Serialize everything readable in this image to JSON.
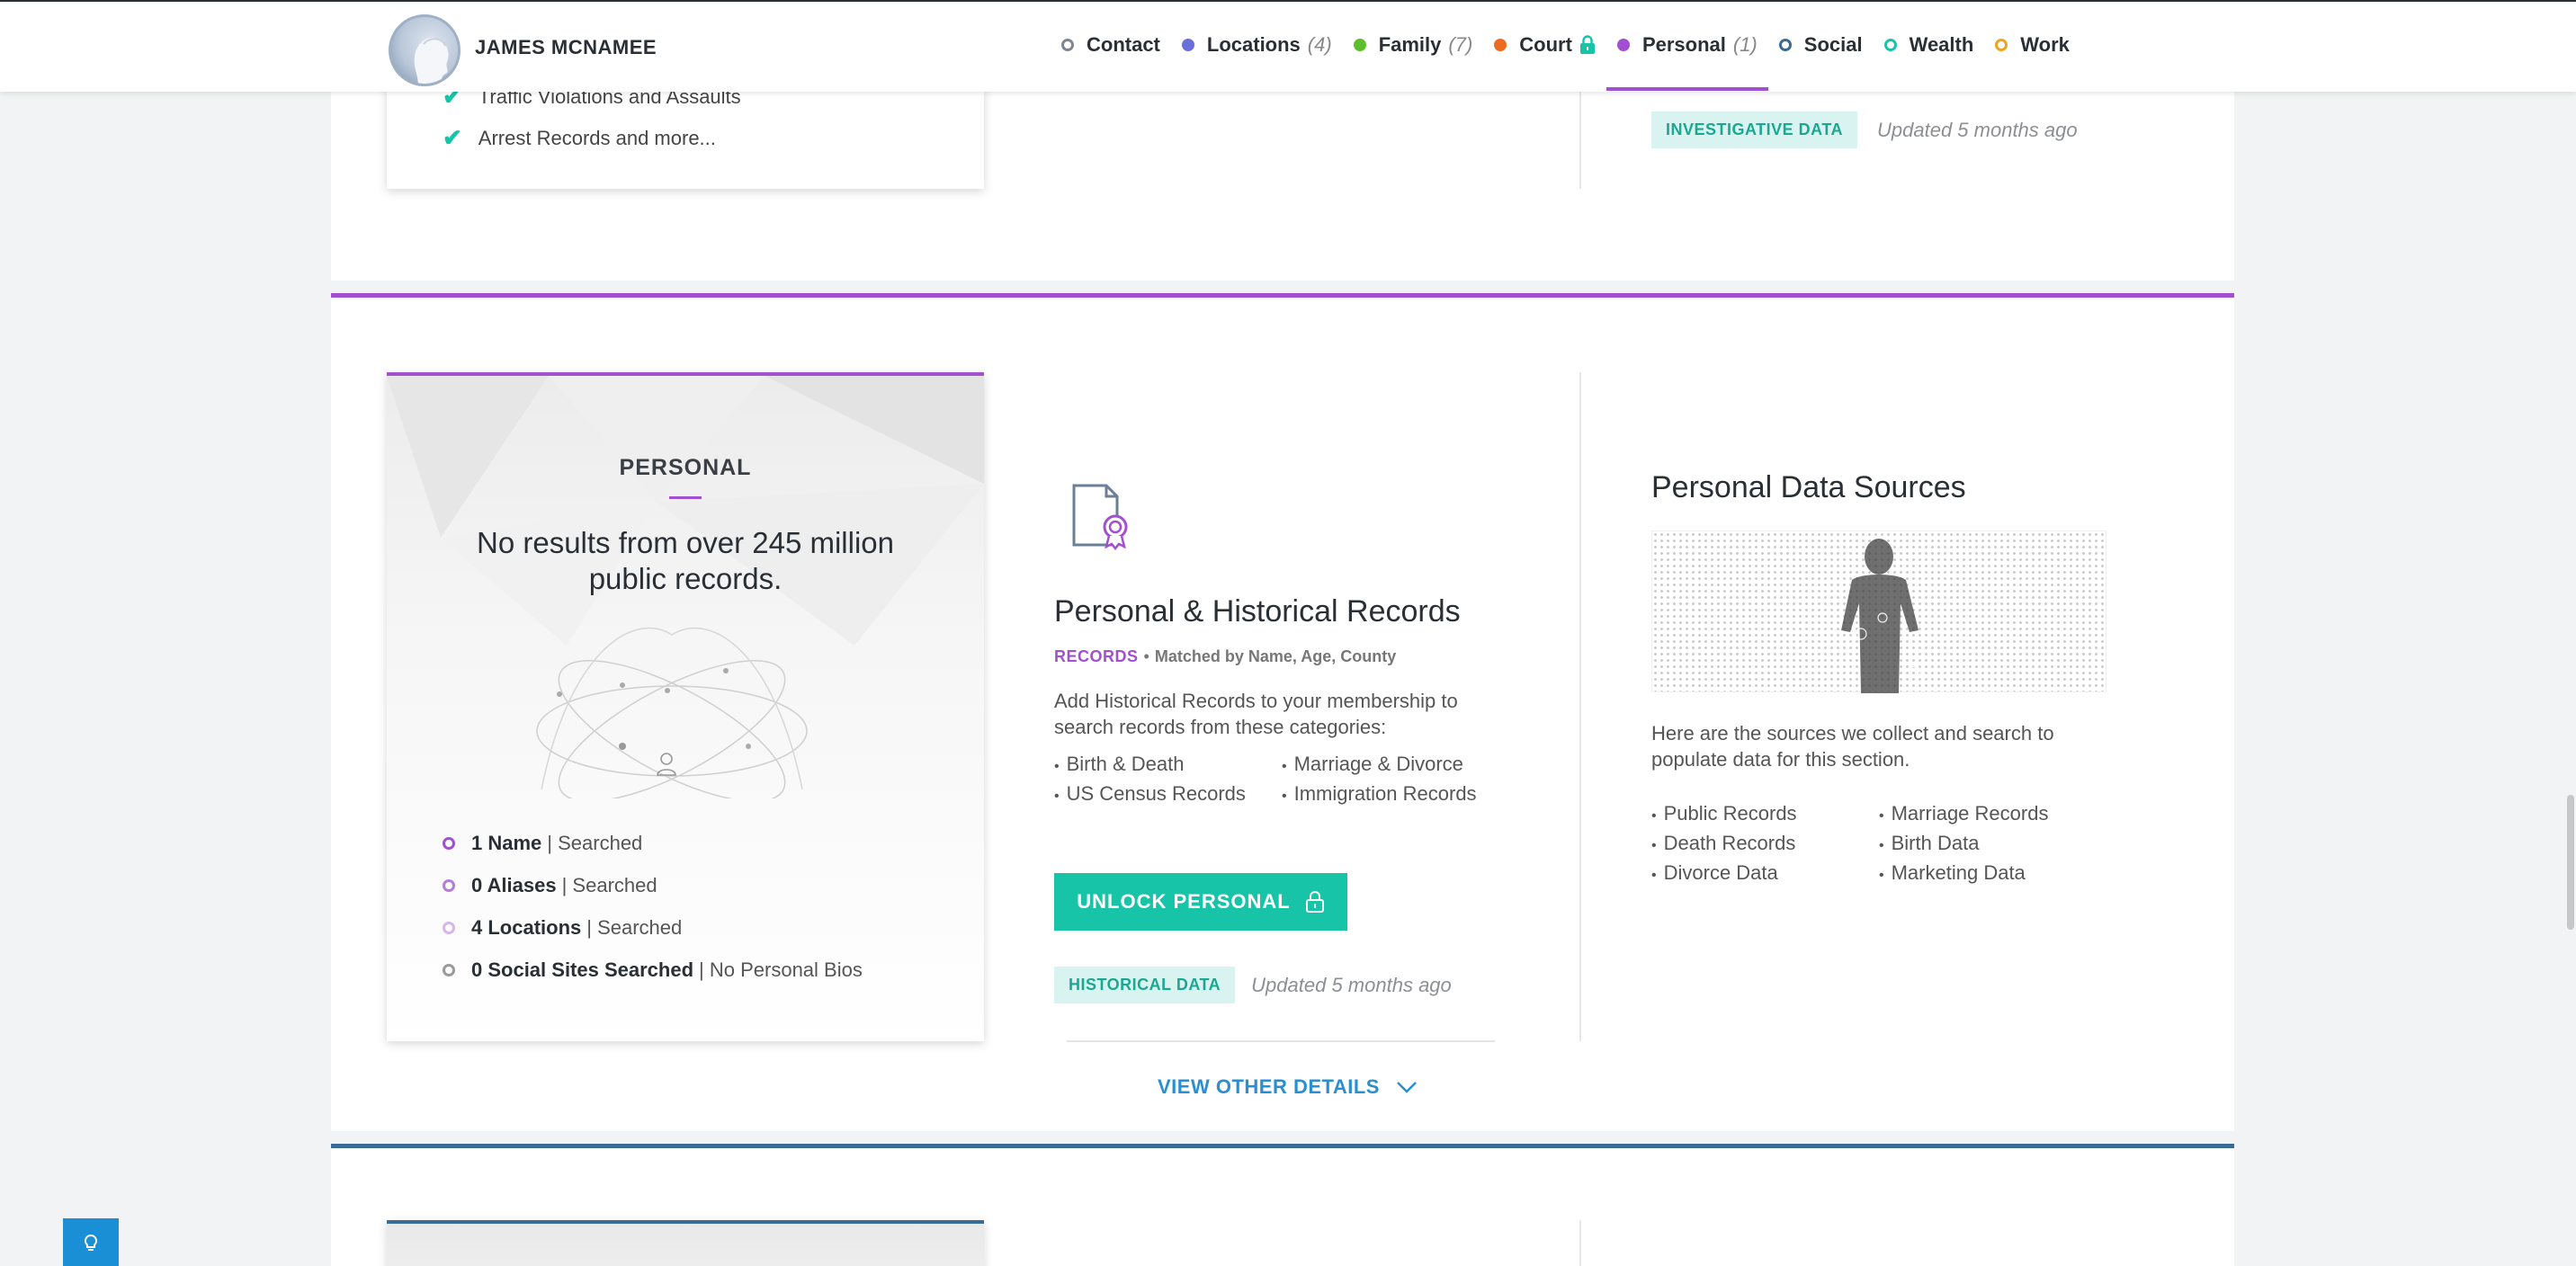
{
  "header": {
    "person_name": "JAMES MCNAMEE",
    "nav": [
      {
        "label": "Contact",
        "count": "",
        "dot_color": "#7f8690",
        "hollow": true,
        "locked": false,
        "active": false
      },
      {
        "label": "Locations",
        "count": "(4)",
        "dot_color": "#6a6fd9",
        "hollow": false,
        "locked": false,
        "active": false
      },
      {
        "label": "Family",
        "count": "(7)",
        "dot_color": "#5cbf2a",
        "hollow": false,
        "locked": false,
        "active": false
      },
      {
        "label": "Court",
        "count": "",
        "dot_color": "#ee6a1e",
        "hollow": false,
        "locked": true,
        "active": false
      },
      {
        "label": "Personal",
        "count": "(1)",
        "dot_color": "#a24fd0",
        "hollow": false,
        "locked": false,
        "active": true
      },
      {
        "label": "Social",
        "count": "",
        "dot_color": "#3a6b97",
        "hollow": true,
        "locked": false,
        "active": false
      },
      {
        "label": "Wealth",
        "count": "",
        "dot_color": "#18c4a8",
        "hollow": true,
        "locked": false,
        "active": false
      },
      {
        "label": "Work",
        "count": "",
        "dot_color": "#f0a41b",
        "hollow": true,
        "locked": false,
        "active": false
      }
    ]
  },
  "court_section": {
    "checks": [
      "Traffic Violations and Assaults",
      "Arrest Records and more..."
    ],
    "pill": "INVESTIGATIVE DATA",
    "updated": "Updated 5 months ago"
  },
  "personal_section": {
    "card": {
      "title": "PERSONAL",
      "summary": "No results from over 245 million public records.",
      "stats": [
        {
          "bold": "1 Name",
          "rest": "| Searched",
          "ring_color": "#a24fd0"
        },
        {
          "bold": "0 Aliases",
          "rest": "| Searched",
          "ring_color": "#b77bd8"
        },
        {
          "bold": "4 Locations",
          "rest": "| Searched",
          "ring_color": "#d6b5e8"
        },
        {
          "bold": "0 Social Sites Searched",
          "rest": "| No Personal Bios",
          "ring_color": "#9a9a9a"
        }
      ]
    },
    "middle": {
      "title": "Personal & Historical Records",
      "meta_tag": "RECORDS",
      "meta_sep": "•",
      "meta_match": "Matched by Name, Age, County",
      "description": "Add Historical Records to your membership to search records from these categories:",
      "bullets": [
        "Birth & Death",
        "Marriage & Divorce",
        "US Census Records",
        "Immigration Records"
      ],
      "unlock_label": "UNLOCK PERSONAL",
      "pill": "HISTORICAL DATA",
      "updated": "Updated 5 months ago",
      "view_other": "VIEW OTHER DETAILS"
    },
    "right": {
      "title": "Personal Data Sources",
      "description": "Here are the sources we collect and search to populate data for this section.",
      "bullets": [
        "Public Records",
        "Marriage Records",
        "Death Records",
        "Birth Data",
        "Divorce Data",
        "Marketing Data"
      ]
    }
  },
  "colors": {
    "accent_personal": "#a24fd0",
    "accent_teal": "#18c4a8",
    "link_blue": "#2a8fd0",
    "social_blue": "#3a6b97"
  }
}
